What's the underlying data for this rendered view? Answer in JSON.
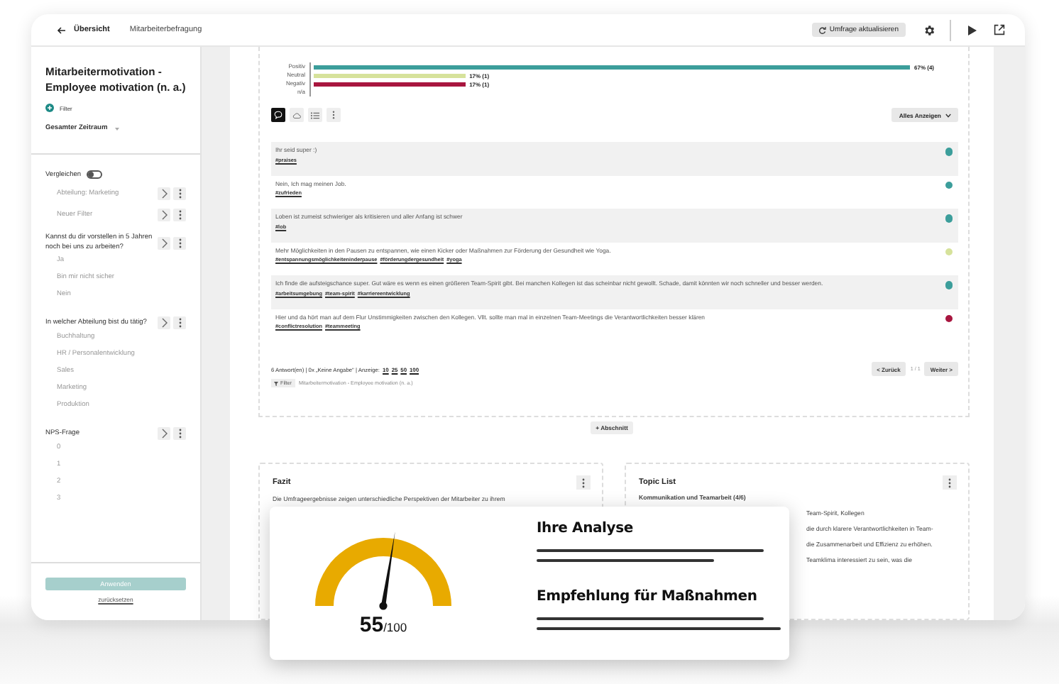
{
  "top_bar": {
    "back": "Übersicht",
    "breadcrumb": "Mitarbeiterbefragung",
    "refresh": "Umfrage aktualisieren"
  },
  "sidebar": {
    "title": "Mitarbeitermotivation - Employee motivation (n. a.)",
    "add_filter": "Filter",
    "period": "Gesamter Zeitraum",
    "compare": {
      "label": "Vergleichen",
      "on": false
    },
    "filters": [
      "Abteilung: Marketing",
      "Neuer Filter"
    ],
    "questions": [
      {
        "title": "Kannst du dir vorstellen in 5 Jahren noch bei uns zu arbeiten?",
        "options": [
          "Ja",
          "Bin mir nicht sicher",
          "Nein"
        ]
      },
      {
        "title": "In welcher Abteilung bist du tätig?",
        "options": [
          "Buchhaltung",
          "HR / Personalentwicklung",
          "Sales",
          "Marketing",
          "Produktion"
        ]
      },
      {
        "title": "NPS-Frage",
        "options": [
          "0",
          "1",
          "2",
          "3"
        ]
      }
    ],
    "apply": "Anwenden",
    "reset": "zurücksetzen"
  },
  "sentiment": {
    "chart_data": {
      "type": "bar",
      "orientation": "horizontal",
      "stacked": true,
      "categories": [
        "Positiv",
        "Neutral",
        "Negativ",
        "n/a"
      ],
      "series": [
        {
          "color": "#3c9e9b",
          "values": [
            67,
            null,
            null,
            null
          ],
          "value_labels": [
            "67% (4)",
            null,
            null,
            null
          ]
        },
        {
          "color": "#d6e29b",
          "values": [
            null,
            17,
            null,
            null
          ],
          "value_labels": [
            null,
            "17% (1)",
            null,
            null
          ]
        },
        {
          "color": "#a8163f",
          "values": [
            null,
            null,
            17,
            null
          ],
          "value_labels": [
            null,
            null,
            "17% (1)",
            null
          ]
        }
      ],
      "data_labels": true
    }
  },
  "view_buttons": [
    {
      "kind": "comments",
      "selected": true
    },
    {
      "kind": "cloud",
      "selected": false
    },
    {
      "kind": "list",
      "selected": false
    },
    {
      "kind": "more",
      "selected": false
    }
  ],
  "show_all": "Alles Anzeigen",
  "responses": [
    {
      "text": "Ihr seid super :)",
      "tags": [
        "#praises"
      ],
      "color": "#3c9e9b"
    },
    {
      "text": "Nein, Ich mag meinen Job.",
      "tags": [
        "#zufrieden"
      ],
      "color": "#3c9e9b"
    },
    {
      "text": "Loben ist zumeist schwieriger als kritisieren und aller Anfang ist schwer",
      "tags": [
        "#lob"
      ],
      "color": "#3c9e9b"
    },
    {
      "text": "Mehr Möglichkeiten in den Pausen zu entspannen, wie einen Kicker oder Maßnahmen zur Förderung der Gesundheit wie Yoga.",
      "tags": [
        "#entspannungsmöglichkeiteninderpause",
        "#förderungdergesundheit",
        "#yoga"
      ],
      "color": "#d6e29b"
    },
    {
      "text": "Ich finde die aufsteigschance super. Gut wäre es wenn es einen größeren Team-Spirit gibt. Bei manchen Kollegen ist das scheinbar nicht gewollt. Schade, damit könnten wir noch schneller und besser werden.",
      "tags": [
        "#arbeitsumgebung",
        "#team-spirit",
        "#karriereentwicklung"
      ],
      "color": "#3c9e9b"
    },
    {
      "text": "Hier und da hört man auf dem Flur Unstimmigkeiten zwischen den Kollegen. Vllt. sollte man mal in einzelnen Team-Meetings die Verantwortlichkeiten besser klären",
      "tags": [
        "#conflictresolution",
        "#teammeeting"
      ],
      "color": "#a8163f"
    }
  ],
  "pagination": {
    "summary": "6 Antwort(en) | 0x „Keine Angabe\" | Anzeige:",
    "page_sizes": [
      "10",
      "25",
      "50",
      "100"
    ],
    "prev": "< Zurück",
    "page": "1 / 1",
    "next": "Weiter >"
  },
  "filter_chip": {
    "label": "Filter",
    "text": "Mitarbeitermotivation - Employee motivation (n. a.)"
  },
  "add_section": "+ Abschnitt",
  "cards": [
    {
      "title": "Fazit",
      "lines": [
        "Die Umfrageergebnisse zeigen unterschiedliche Perspektiven der Mitarbeiter zu ihrem"
      ]
    },
    {
      "title": "Topic List",
      "lines": [
        "Kommunikation und Teamarbeit (4/6)",
        "Team-Spirit, Kollegen",
        "die durch klarere Verantwortlichkeiten in Team-",
        "die Zusammenarbeit und Effizienz zu erhöhen.",
        "Teamklima interessiert zu sein, was die"
      ]
    }
  ],
  "analysis": {
    "gauge": {
      "level": 0.55,
      "score": "55",
      "max": "/100"
    },
    "headings": [
      "Ihre Analyse",
      "Empfehlung für Maßnahmen"
    ]
  }
}
